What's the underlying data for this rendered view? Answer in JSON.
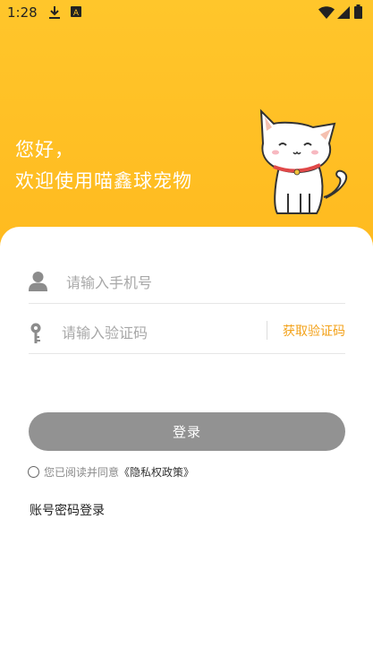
{
  "status_bar": {
    "time": "1:28",
    "left_icons": [
      "download-icon",
      "text-a-icon"
    ],
    "right_icons": [
      "wifi-icon",
      "signal-icon",
      "battery-icon"
    ]
  },
  "greeting": {
    "line1": "您好，",
    "line2": "欢迎使用喵鑫球宠物"
  },
  "form": {
    "phone_placeholder": "请输入手机号",
    "code_placeholder": "请输入验证码",
    "get_code_label": "获取验证码",
    "login_label": "登录"
  },
  "agreement": {
    "prefix": "您已阅读并同意",
    "link": "《隐私权政策》"
  },
  "password_login_label": "账号密码登录",
  "colors": {
    "accent": "#f3a21a",
    "header_gradient_top": "#ffc62b",
    "header_gradient_bottom": "#ffae10",
    "button_disabled": "#929292"
  }
}
